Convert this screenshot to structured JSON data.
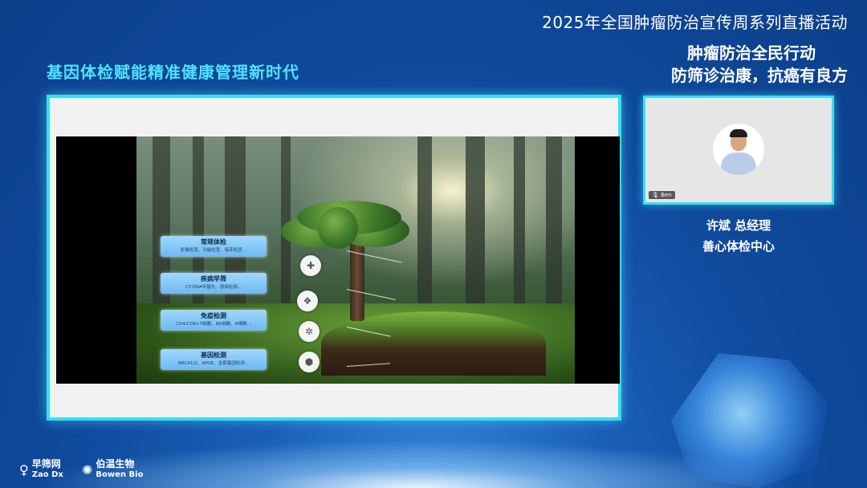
{
  "header": {
    "broadcast_title": "2025年全国肿瘤防治宣传周系列直播活动",
    "slogan_line1": "肿瘤防治全民行动",
    "slogan_line2": "防筛诊治康，抗癌有良方"
  },
  "topic_title": "基因体检赋能精准健康管理新时代",
  "slide": {
    "items": [
      {
        "title": "常规体检",
        "subtitle": "影像检查、功能检查、临床检查..."
      },
      {
        "title": "疾病早筛",
        "subtitle": "CT-DNA甲基化、感染检测..."
      },
      {
        "title": "免疫检测",
        "subtitle": "CD4/CD8+T细胞、NK细胞、B细胞..."
      },
      {
        "title": "基因检测",
        "subtitle": "BRCA1/2、APOE、全套基因检测..."
      }
    ]
  },
  "video": {
    "participant_name": "Ben"
  },
  "speaker": {
    "name_title": "许斌  总经理",
    "organization": "善心体检中心"
  },
  "logos": {
    "zaodx_cn": "早筛网",
    "zaodx_en": "Zao Dx",
    "bowen_cn": "伯温生物",
    "bowen_en": "Bowen Bio"
  },
  "colors": {
    "accent_cyan": "#34e0f0",
    "topic_cyan": "#4fe3ff",
    "background": "#0f4a9c"
  }
}
